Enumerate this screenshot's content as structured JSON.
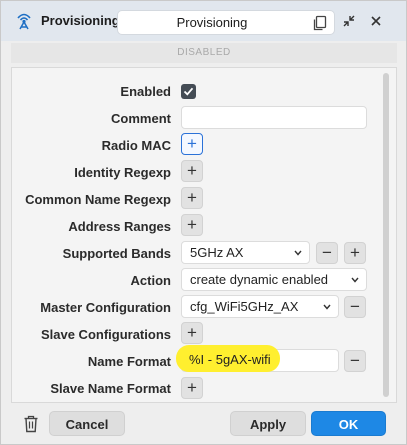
{
  "window": {
    "title": "Provisioning",
    "name_field_value": "Provisioning",
    "status_text": "DISABLED"
  },
  "form": {
    "enabled": {
      "label": "Enabled",
      "checked": true
    },
    "comment": {
      "label": "Comment",
      "value": ""
    },
    "radio_mac": {
      "label": "Radio MAC"
    },
    "identity_regexp": {
      "label": "Identity Regexp"
    },
    "common_name_regexp": {
      "label": "Common Name Regexp"
    },
    "address_ranges": {
      "label": "Address Ranges"
    },
    "supported_bands": {
      "label": "Supported Bands",
      "value": "5GHz AX"
    },
    "action": {
      "label": "Action",
      "value": "create dynamic enabled"
    },
    "master_configuration": {
      "label": "Master Configuration",
      "value": "cfg_WiFi5GHz_AX"
    },
    "slave_configurations": {
      "label": "Slave Configurations"
    },
    "name_format": {
      "label": "Name Format",
      "value": "%I - 5gAX-wifi"
    },
    "slave_name_format": {
      "label": "Slave Name Format"
    }
  },
  "buttons": {
    "add": "+",
    "remove": "−",
    "cancel": "Cancel",
    "apply": "Apply",
    "ok": "OK"
  },
  "icons": {
    "window": "antenna-icon",
    "copy": "copy-icon",
    "collapse": "collapse-icon",
    "close": "close-icon",
    "delete": "trash-icon",
    "dropdown": "chevron-down-icon",
    "check": "check-icon"
  },
  "colors": {
    "accent": "#1e88e5",
    "highlight": "#ffef2f",
    "title_bar": "#e1e7ee"
  }
}
